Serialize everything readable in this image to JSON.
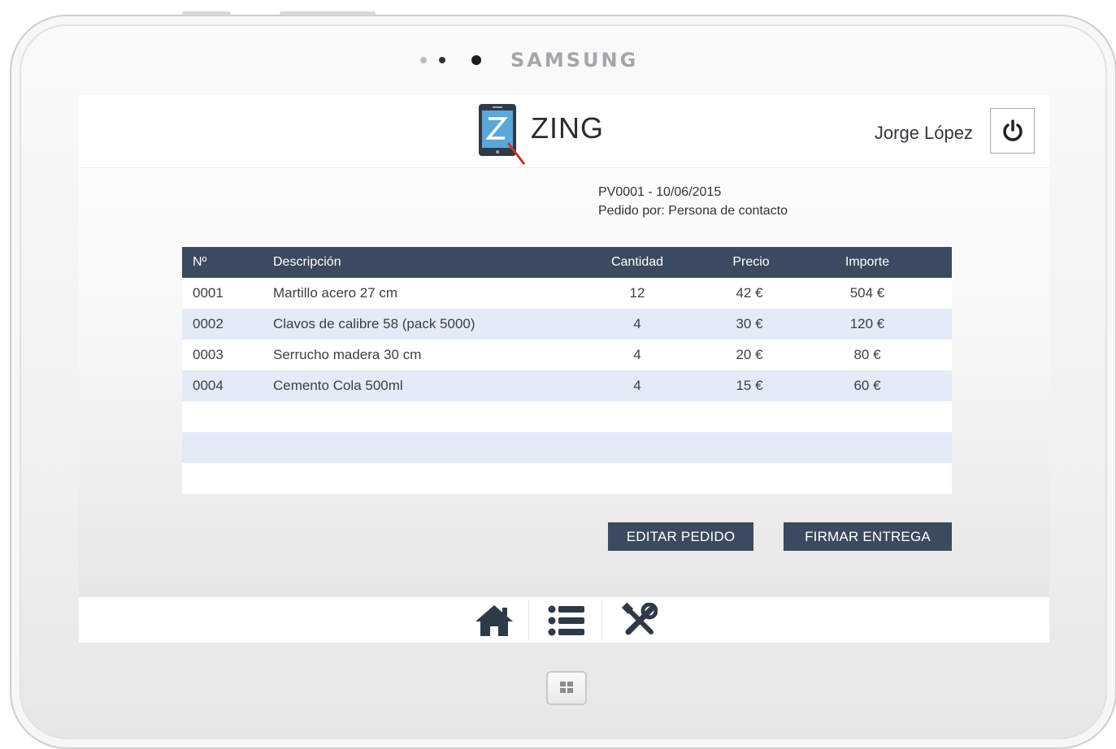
{
  "device": {
    "brand": "SAMSUNG"
  },
  "app": {
    "name": "ZING",
    "user": "Jorge López"
  },
  "order": {
    "reference": "PV0001 - 10/06/2015",
    "ordered_by": "Pedido por: Persona de contacto"
  },
  "table": {
    "columns": [
      "Nº",
      "Descripción",
      "Cantidad",
      "Precio",
      "Importe"
    ],
    "rows": [
      [
        "0001",
        "Martillo acero 27 cm",
        "12",
        "42 €",
        "504 €"
      ],
      [
        "0002",
        "Clavos de calibre 58 (pack 5000)",
        "4",
        "30 €",
        "120 €"
      ],
      [
        "0003",
        "Serrucho madera 30 cm",
        "4",
        "20 €",
        "80 €"
      ],
      [
        "0004",
        "Cemento Cola 500ml",
        "4",
        "15 €",
        "60 €"
      ]
    ]
  },
  "actions": {
    "edit": "EDITAR PEDIDO",
    "sign": "FIRMAR ENTREGA"
  },
  "nav": [
    "home-icon",
    "list-icon",
    "tools-icon"
  ],
  "colors": {
    "primary": "#3b4a5e",
    "row_alt": "#e3ebf7",
    "accent": "#c0392b"
  }
}
